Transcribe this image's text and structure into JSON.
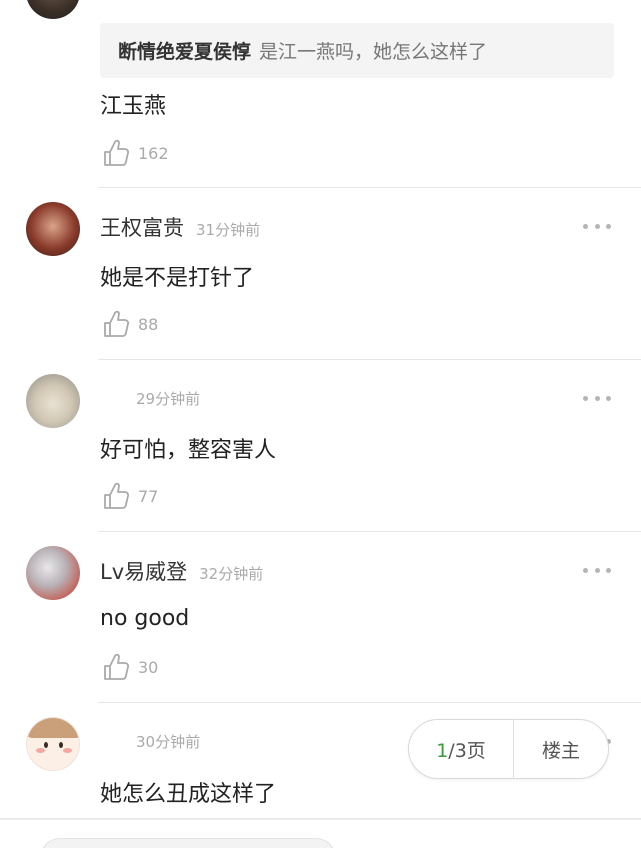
{
  "quote": {
    "user": "断情绝爱夏侯惇",
    "text": "是江一燕吗，她怎么这样了"
  },
  "comments": [
    {
      "name": "",
      "time": "",
      "content": "江玉燕",
      "likes": "162"
    },
    {
      "name": "王权富贵",
      "time": "31分钟前",
      "content": "她是不是打针了",
      "likes": "88"
    },
    {
      "name": "",
      "time": "29分钟前",
      "content": "好可怕，整容害人",
      "likes": "77"
    },
    {
      "name": "Lv易威登",
      "time": "32分钟前",
      "content": "no good",
      "likes": "30"
    },
    {
      "name": "",
      "time": "30分钟前",
      "content": "她怎么丑成这样了",
      "likes": ""
    }
  ],
  "pager": {
    "current": "1",
    "total": "/3页",
    "op_label": "楼主"
  },
  "icons": {
    "like": "thumbs-up-icon",
    "more": "more-dots-icon"
  },
  "colors": {
    "accent": "#3b9a3b",
    "muted": "#aaaaaa"
  }
}
